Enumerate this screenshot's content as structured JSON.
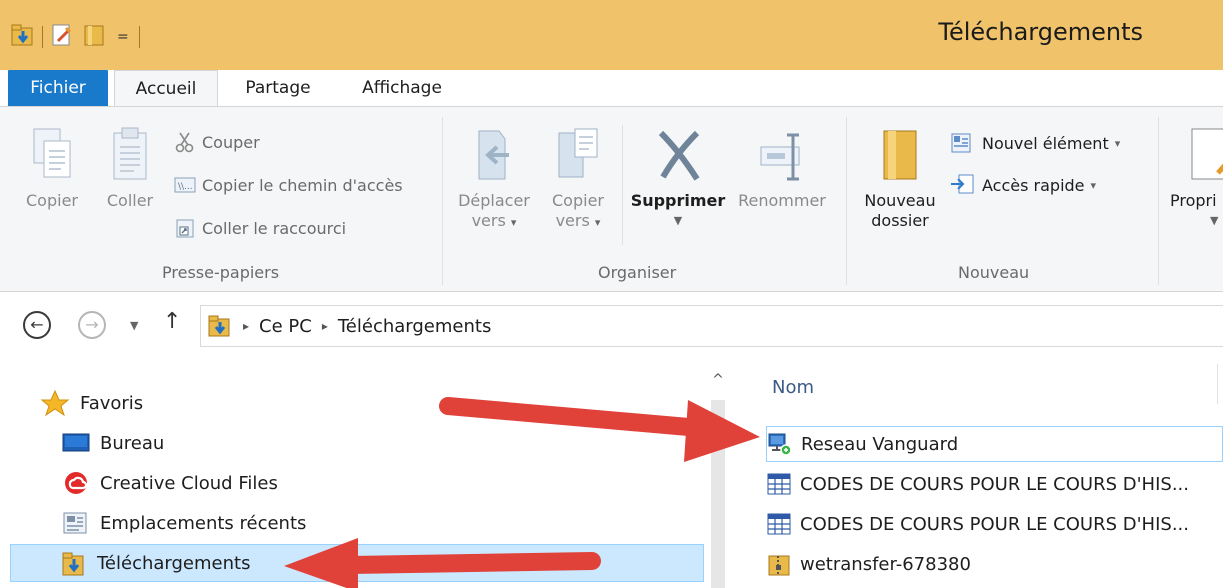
{
  "window": {
    "title": "Téléchargements",
    "quick_access_dropdown": "="
  },
  "ribbon_tabs": [
    {
      "label": "Fichier"
    },
    {
      "label": "Accueil"
    },
    {
      "label": "Partage"
    },
    {
      "label": "Affichage"
    }
  ],
  "ribbon": {
    "clipboard": {
      "copy_label": "Copier",
      "paste_label": "Coller",
      "cut_label": "Couper",
      "copy_path_label": "Copier le chemin d'accès",
      "paste_shortcut_label": "Coller le raccourci",
      "group_label": "Presse-papiers"
    },
    "organize": {
      "move_to_label_line1": "Déplacer",
      "move_to_label_line2": "vers",
      "copy_to_label_line1": "Copier",
      "copy_to_label_line2": "vers",
      "delete_label": "Supprimer",
      "rename_label": "Renommer",
      "group_label": "Organiser"
    },
    "new": {
      "new_folder_label_line1": "Nouveau",
      "new_folder_label_line2": "dossier",
      "new_item_label": "Nouvel élément",
      "easy_access_label": "Accès rapide",
      "group_label": "Nouveau"
    },
    "open": {
      "properties_label": "Propri"
    }
  },
  "address_bar": {
    "crumbs": [
      "Ce PC",
      "Téléchargements"
    ]
  },
  "nav_pane": {
    "items": [
      {
        "label": "Favoris",
        "icon": "star-icon"
      },
      {
        "label": "Bureau",
        "icon": "desktop-icon"
      },
      {
        "label": "Creative Cloud Files",
        "icon": "creative-cloud-icon"
      },
      {
        "label": "Emplacements récents",
        "icon": "recent-places-icon"
      },
      {
        "label": "Téléchargements",
        "icon": "downloads-folder-icon",
        "selected": true
      }
    ]
  },
  "file_list": {
    "column_name": "Nom",
    "files": [
      {
        "name": "Reseau Vanguard",
        "icon": "network-shortcut-icon"
      },
      {
        "name": "CODES DE COURS POUR LE COURS D'HIS...",
        "icon": "spreadsheet-icon"
      },
      {
        "name": "CODES DE COURS POUR LE COURS D'HIS...",
        "icon": "spreadsheet-icon"
      },
      {
        "name": "wetransfer-678380",
        "icon": "zip-folder-icon"
      }
    ]
  },
  "colors": {
    "title_bar": "#f0c36a",
    "file_tab": "#1979ca",
    "ribbon_bg": "#f5f6f7",
    "selection": "#cce8ff",
    "annotation_arrow": "#e0423a"
  }
}
